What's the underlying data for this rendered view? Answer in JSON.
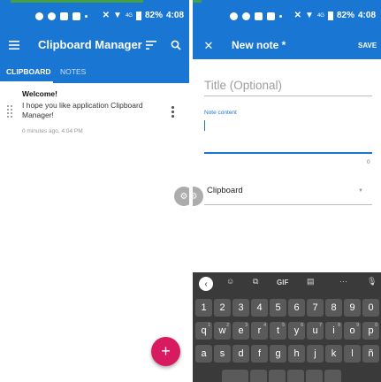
{
  "status": {
    "battery": "82%",
    "time": "4:08",
    "network": "4G"
  },
  "left": {
    "appbar": {
      "title": "Clipboard Manager"
    },
    "tabs": [
      {
        "label": "CLIPBOARD",
        "active": true
      },
      {
        "label": "NOTES",
        "active": false
      }
    ],
    "note": {
      "title": "Welcome!",
      "body": "I hope you like application Clipboard Manager!",
      "meta": "0 minutes ago, 4:04 PM"
    },
    "fab_icon": "+"
  },
  "right": {
    "appbar": {
      "title": "New note *",
      "save_label": "SAVE"
    },
    "title_placeholder": "Title (Optional)",
    "content_label": "Note content",
    "counter": "0",
    "dropdown_value": "Clipboard"
  },
  "keyboard": {
    "toolbar": [
      "GIF"
    ],
    "row_numbers": [
      "1",
      "2",
      "3",
      "4",
      "5",
      "6",
      "7",
      "8",
      "9",
      "0"
    ],
    "row_q": [
      "q",
      "w",
      "e",
      "r",
      "t",
      "y",
      "u",
      "i",
      "o",
      "p"
    ],
    "row_q_sup": [
      "1",
      "2",
      "3",
      "4",
      "5",
      "6",
      "7",
      "8",
      "9",
      "0"
    ],
    "row_a": [
      "a",
      "s",
      "d",
      "f",
      "g",
      "h",
      "j",
      "k",
      "l",
      "ñ"
    ]
  },
  "colors": {
    "primary": "#1976d2",
    "accent": "#d81b60",
    "keyboard_bg": "#3a3a3a",
    "key_bg": "#5a5a5a"
  }
}
